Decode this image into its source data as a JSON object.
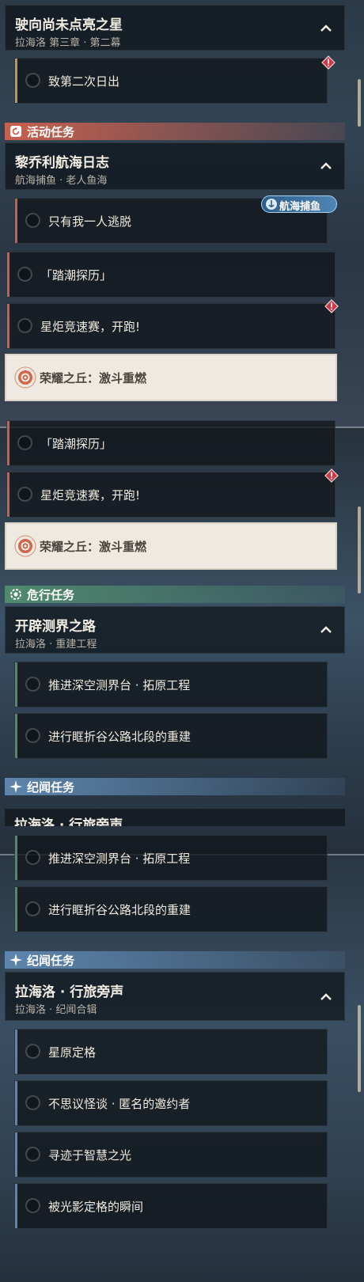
{
  "colors": {
    "activity_accent": "#c8604f",
    "danger_accent": "#4f8a6e",
    "story_accent": "#5d85ad",
    "alert_red": "#c83c4c",
    "active_card_bg": "#eeeae1",
    "badge_blue": "#4f86b6"
  },
  "panel1": {
    "main_quest": {
      "title": "驶向尚未点亮之星",
      "subtitle": "拉海洛 第三章 · 第二幕",
      "icon": "chevron-up-icon"
    },
    "main_task": {
      "label": "致第二次日出",
      "alert_icon": "alert-diamond-icon"
    },
    "activity_category": {
      "label": "活动任务",
      "icon": "activity-refresh-icon"
    },
    "activity_quest": {
      "title": "黎乔利航海日志",
      "subtitle": "航海捕鱼 · 老人鱼海",
      "icon": "chevron-up-icon"
    },
    "badge": {
      "label": "航海捕鱼",
      "icon": "anchor-wave-icon"
    },
    "tasks": [
      {
        "label": "只有我一人逃脱"
      },
      {
        "label": "「踏潮探历」"
      },
      {
        "label": "星炬竞速赛，开跑!"
      },
      {
        "label": "荣耀之丘：激斗重燃",
        "icon": "target-icon"
      }
    ]
  },
  "panel2": {
    "tasks": [
      {
        "label": "「踏潮探历」"
      },
      {
        "label": "星炬竞速赛，开跑!"
      },
      {
        "label": "荣耀之丘：激斗重燃",
        "icon": "target-icon"
      }
    ],
    "danger_category": {
      "label": "危行任务",
      "icon": "gear-badge-icon"
    },
    "danger_quest": {
      "title": "开辟测界之路",
      "subtitle": "拉海洛 · 重建工程",
      "icon": "chevron-up-icon"
    },
    "danger_tasks": [
      {
        "label": "推进深空测界台 · 拓原工程"
      },
      {
        "label": "进行眶折谷公路北段的重建"
      }
    ],
    "story_category": {
      "label": "纪闻任务",
      "icon": "sparkle-icon"
    },
    "peek_title": "拉海洛 · 行旅旁声"
  },
  "panel3": {
    "danger_tasks": [
      {
        "label": "推进深空测界台 · 拓原工程"
      },
      {
        "label": "进行眶折谷公路北段的重建"
      }
    ],
    "story_category": {
      "label": "纪闻任务",
      "icon": "sparkle-icon"
    },
    "story_quest": {
      "title": "拉海洛 · 行旅旁声",
      "subtitle": "拉海洛 · 纪闻合辑",
      "icon": "chevron-up-icon"
    },
    "story_tasks": [
      {
        "label": "星原定格"
      },
      {
        "label": "不思议怪谈 · 匿名的邀约者"
      },
      {
        "label": "寻迹于智慧之光"
      },
      {
        "label": "被光影定格的瞬间"
      }
    ]
  }
}
